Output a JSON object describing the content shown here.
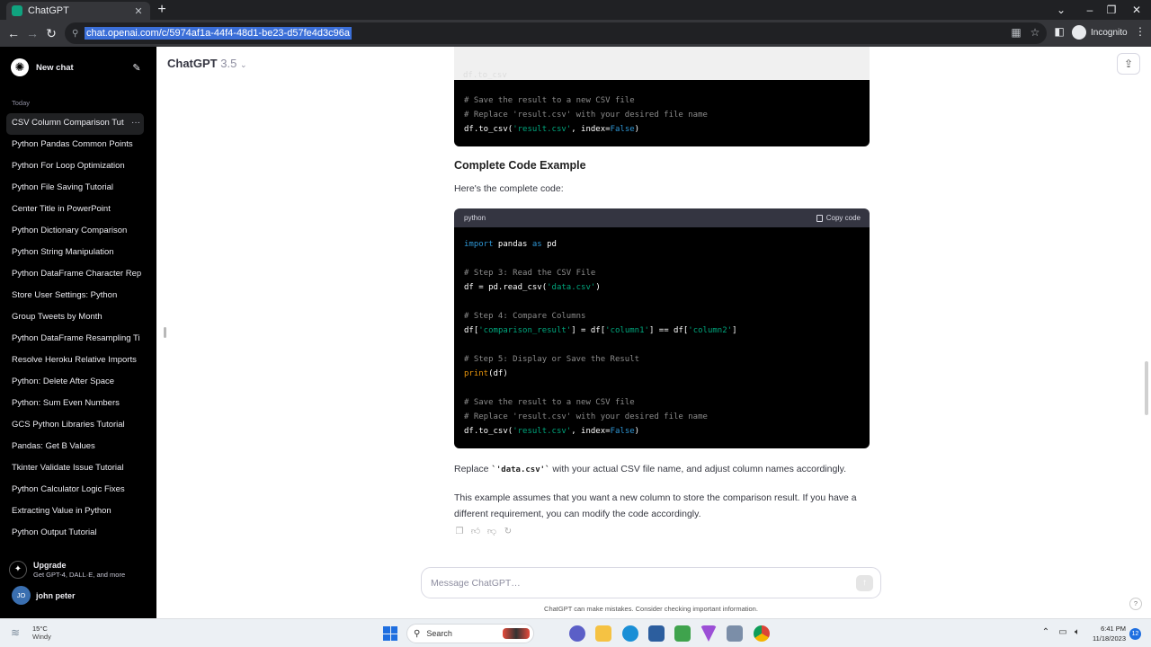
{
  "browser": {
    "tab_title": "ChatGPT",
    "tab_close": "✕",
    "new_tab": "+",
    "url": "chat.openai.com/c/5974af1a-44f4-48d1-be23-d57fe4d3c96a",
    "profile_label": "Incognito"
  },
  "sidebar": {
    "new_chat_label": "New chat",
    "section_label": "Today",
    "items": [
      {
        "label": "CSV Column Comparison Tut"
      },
      {
        "label": "Python Pandas Common Points"
      },
      {
        "label": "Python For Loop Optimization"
      },
      {
        "label": "Python File Saving Tutorial"
      },
      {
        "label": "Center Title in PowerPoint"
      },
      {
        "label": "Python Dictionary Comparison"
      },
      {
        "label": "Python String Manipulation"
      },
      {
        "label": "Python DataFrame Character Rep"
      },
      {
        "label": "Store User Settings: Python"
      },
      {
        "label": "Group Tweets by Month"
      },
      {
        "label": "Python DataFrame Resampling Ti"
      },
      {
        "label": "Resolve Heroku Relative Imports"
      },
      {
        "label": "Python: Delete After Space"
      },
      {
        "label": "Python: Sum Even Numbers"
      },
      {
        "label": "GCS Python Libraries Tutorial"
      },
      {
        "label": "Pandas: Get B Values"
      },
      {
        "label": "Tkinter Validate Issue Tutorial"
      },
      {
        "label": "Python Calculator Logic Fixes"
      },
      {
        "label": "Extracting Value in Python"
      },
      {
        "label": "Python Output Tutorial"
      }
    ],
    "active_dots": "···",
    "upgrade_title": "Upgrade",
    "upgrade_subtitle": "Get GPT-4, DALL·E, and more",
    "user_initials": "JO",
    "user_name": "john peter"
  },
  "header": {
    "model_name": "ChatGPT",
    "model_version": "3.5",
    "chevron": "⌄"
  },
  "top_code": {
    "lines": [
      [
        [
          "# Save the result to a new CSV file",
          "cm"
        ]
      ],
      [
        [
          "# Replace 'result.csv' with your desired file name",
          "cm"
        ]
      ],
      [
        [
          "df.to_csv(",
          ""
        ],
        [
          "'result.csv'",
          "st"
        ],
        [
          ", index=",
          ""
        ],
        [
          "False",
          "kw"
        ],
        [
          ")",
          ""
        ]
      ]
    ]
  },
  "message": {
    "heading": "Complete Code Example",
    "intro": "Here's the complete code:",
    "code_lang": "python",
    "copy_label": "Copy code",
    "code_lines": [
      [
        [
          "import",
          "kw"
        ],
        [
          " pandas ",
          ""
        ],
        [
          "as",
          "kw"
        ],
        [
          " pd",
          ""
        ]
      ],
      [],
      [
        [
          "# Step 3: Read the CSV File",
          "cm"
        ]
      ],
      [
        [
          "df = pd.read_csv(",
          ""
        ],
        [
          "'data.csv'",
          "st"
        ],
        [
          ")",
          ""
        ]
      ],
      [],
      [
        [
          "# Step 4: Compare Columns",
          "cm"
        ]
      ],
      [
        [
          "df[",
          ""
        ],
        [
          "'comparison_result'",
          "st"
        ],
        [
          "] = df[",
          ""
        ],
        [
          "'column1'",
          "st"
        ],
        [
          "] == df[",
          ""
        ],
        [
          "'column2'",
          "st"
        ],
        [
          "]",
          ""
        ]
      ],
      [],
      [
        [
          "# Step 5: Display or Save the Result",
          "cm"
        ]
      ],
      [
        [
          "print",
          "bi"
        ],
        [
          "(df)",
          ""
        ]
      ],
      [],
      [
        [
          "# Save the result to a new CSV file",
          "cm"
        ]
      ],
      [
        [
          "# Replace 'result.csv' with your desired file name",
          "cm"
        ]
      ],
      [
        [
          "df.to_csv(",
          ""
        ],
        [
          "'result.csv'",
          "st"
        ],
        [
          ", index=",
          ""
        ],
        [
          "False",
          "kw"
        ],
        [
          ")",
          ""
        ]
      ]
    ],
    "replace_prefix": "Replace ",
    "replace_code": "`'data.csv'`",
    "replace_suffix": " with your actual CSV file name, and adjust column names accordingly.",
    "assumption_line1": "This example assumes that you want a new column to store the comparison result. If you have a",
    "assumption_line2": "different requirement, you can modify the code accordingly."
  },
  "composer": {
    "placeholder": "Message ChatGPT…",
    "disclaimer": "ChatGPT can make mistakes. Consider checking important information.",
    "help": "?"
  },
  "taskbar": {
    "temperature": "15°C",
    "weather": "Windy",
    "search_label": "Search",
    "time": "6:41 PM",
    "date": "11/18/2023",
    "notifications": "12"
  },
  "colors": {
    "sidebar_bg": "#000000",
    "code_bg": "#000000",
    "code_keyword": "#2e95d3",
    "code_string": "#00a67d",
    "code_comment": "#8b8b8b",
    "code_builtin": "#e9950c",
    "accent": "#10a37f"
  }
}
